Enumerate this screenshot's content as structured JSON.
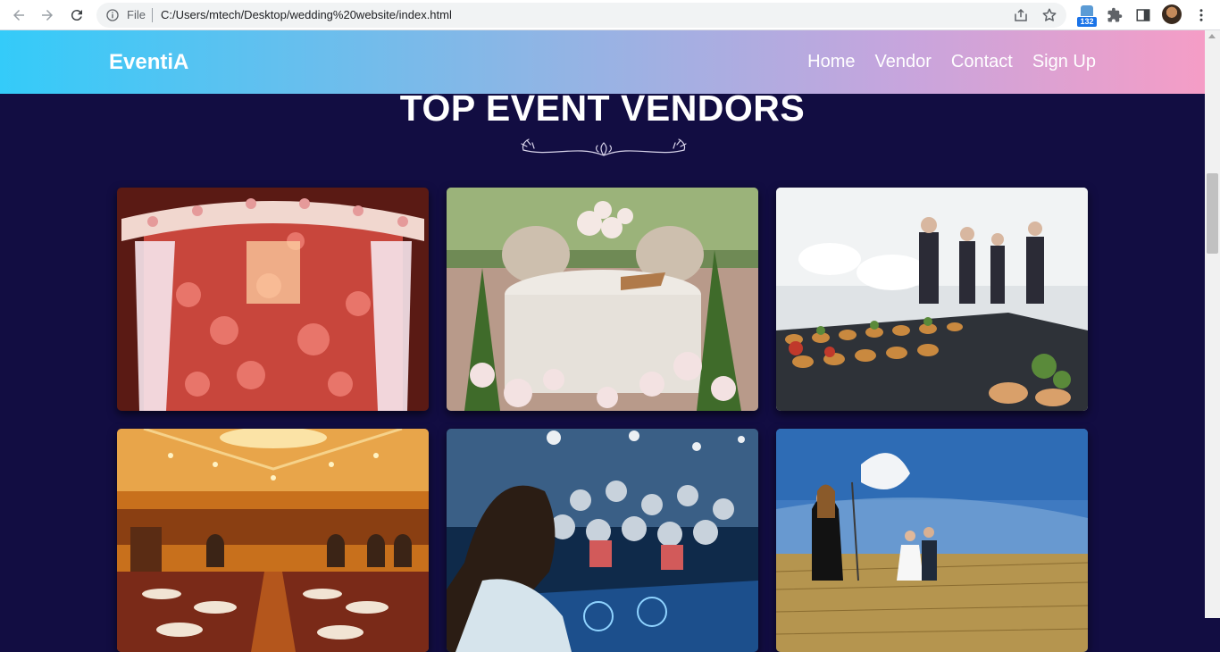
{
  "browser": {
    "file_label": "File",
    "url": "C:/Users/mtech/Desktop/wedding%20website/index.html",
    "extension_badge": "132"
  },
  "site": {
    "brand": "EventiA",
    "nav": [
      {
        "label": "Home"
      },
      {
        "label": "Vendor"
      },
      {
        "label": "Contact"
      },
      {
        "label": "Sign Up"
      }
    ]
  },
  "section": {
    "title": "TOP EVENT VENDORS"
  },
  "colors": {
    "page_bg": "#120d42",
    "header_gradient_start": "#34cbf9",
    "header_gradient_end": "#f59dc6"
  },
  "icons": [
    "back-arrow-icon",
    "forward-arrow-icon",
    "reload-icon",
    "info-icon",
    "share-icon",
    "star-icon",
    "puzzle-icon",
    "side-panel-icon",
    "kebab-menu-icon"
  ]
}
